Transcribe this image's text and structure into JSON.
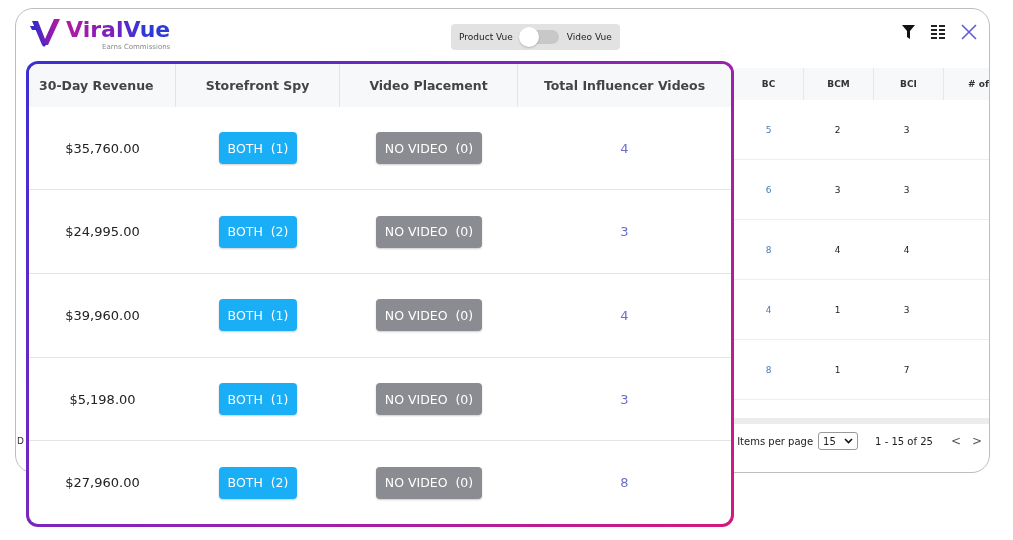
{
  "header": {
    "logo": {
      "name": "ViralVue",
      "tagline": "Earns Commissions"
    },
    "toggle": {
      "left_label": "Product Vue",
      "right_label": "Video Vue",
      "on": false
    }
  },
  "table": {
    "columns": [
      "BC",
      "BCM",
      "BCI",
      "# of"
    ],
    "rows": [
      {
        "bc": "5",
        "bcm": "2",
        "bci": "3"
      },
      {
        "bc": "6",
        "bcm": "3",
        "bci": "3"
      },
      {
        "bc": "8",
        "bcm": "4",
        "bci": "4"
      },
      {
        "bc": "4",
        "bcm": "1",
        "bci": "3"
      },
      {
        "bc": "8",
        "bcm": "1",
        "bci": "7"
      }
    ]
  },
  "footer": {
    "text": "D",
    "items_per_page_label": "Items per page",
    "items_per_page": "15",
    "range": "1 - 15 of 25",
    "prev": "<",
    "next": ">"
  },
  "zoomed_table": {
    "columns": [
      "30-Day Revenue",
      "Storefront Spy",
      "Video Placement",
      "Total Influencer Videos"
    ],
    "rows": [
      {
        "revenue": "$35,760.00",
        "storefront": {
          "label": "BOTH  (1)",
          "kind": "both"
        },
        "placement": {
          "label": "NO VIDEO  (0)",
          "kind": "no_video"
        },
        "videos": "4"
      },
      {
        "revenue": "$24,995.00",
        "storefront": {
          "label": "BOTH  (2)",
          "kind": "both"
        },
        "placement": {
          "label": "NO VIDEO  (0)",
          "kind": "no_video"
        },
        "videos": "3"
      },
      {
        "revenue": "$39,960.00",
        "storefront": {
          "label": "BOTH  (1)",
          "kind": "both"
        },
        "placement": {
          "label": "NO VIDEO  (0)",
          "kind": "no_video"
        },
        "videos": "4"
      },
      {
        "revenue": "$5,198.00",
        "storefront": {
          "label": "BOTH  (1)",
          "kind": "both"
        },
        "placement": {
          "label": "NO VIDEO  (0)",
          "kind": "no_video"
        },
        "videos": "3"
      },
      {
        "revenue": "$27,960.00",
        "storefront": {
          "label": "BOTH  (2)",
          "kind": "both"
        },
        "placement": {
          "label": "NO VIDEO  (0)",
          "kind": "no_video"
        },
        "videos": "8"
      }
    ]
  }
}
